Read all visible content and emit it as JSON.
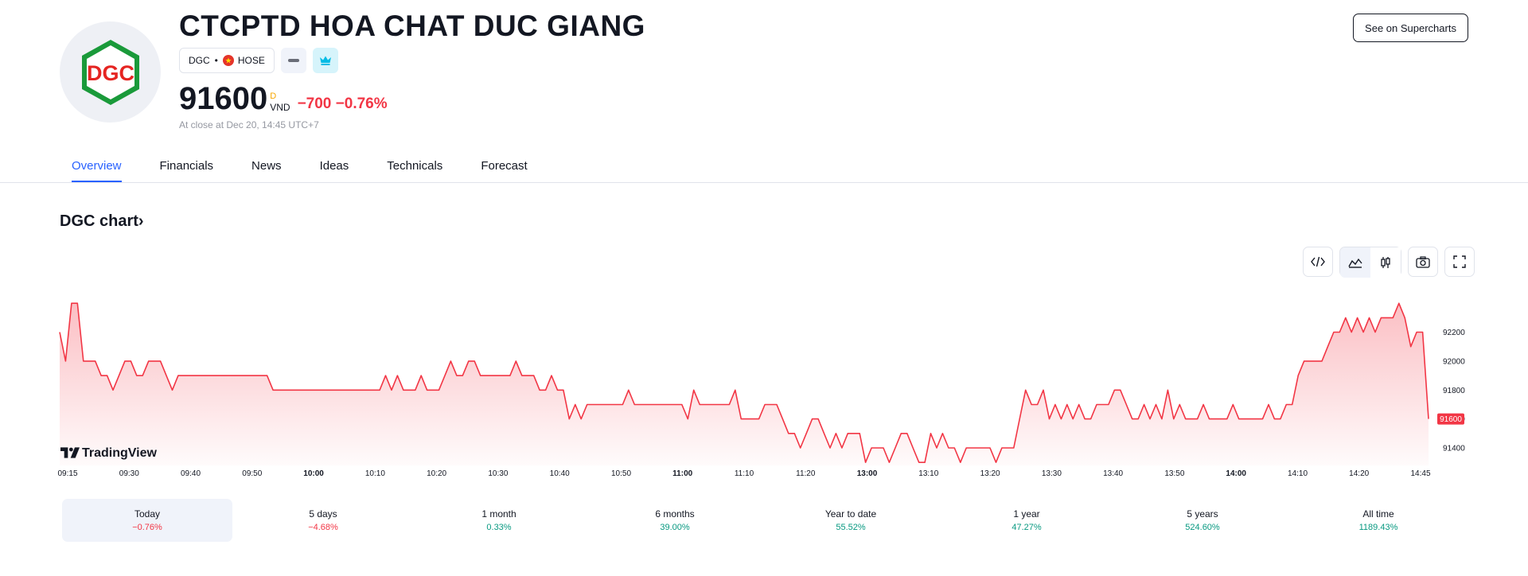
{
  "header": {
    "company_name": "CTCPTD HOA CHAT DUC GIANG",
    "logo_text": "DGC",
    "ticker": "DGC",
    "exchange": "HOSE",
    "price": "91600",
    "price_flag": "D",
    "currency": "VND",
    "change": "−700",
    "change_percent": "−0.76%",
    "close_note": "At close at Dec 20, 14:45 UTC+7",
    "supercharts_label": "See on Supercharts"
  },
  "tabs": [
    "Overview",
    "Financials",
    "News",
    "Ideas",
    "Technicals",
    "Forecast"
  ],
  "chart_section": {
    "title": "DGC chart",
    "title_chevron": "›",
    "watermark": "TradingView",
    "last_price_label": "91600"
  },
  "periods": [
    {
      "label": "Today",
      "value": "−0.76%",
      "trend": "neg"
    },
    {
      "label": "5 days",
      "value": "−4.68%",
      "trend": "neg"
    },
    {
      "label": "1 month",
      "value": "0.33%",
      "trend": "pos"
    },
    {
      "label": "6 months",
      "value": "39.00%",
      "trend": "pos"
    },
    {
      "label": "Year to date",
      "value": "55.52%",
      "trend": "pos"
    },
    {
      "label": "1 year",
      "value": "47.27%",
      "trend": "pos"
    },
    {
      "label": "5 years",
      "value": "524.60%",
      "trend": "pos"
    },
    {
      "label": "All time",
      "value": "1189.43%",
      "trend": "pos"
    }
  ],
  "colors": {
    "accent": "#2962ff",
    "negative": "#f23645",
    "positive": "#089981",
    "line": "#f23645"
  },
  "chart_data": {
    "type": "area",
    "title": "DGC chart",
    "xlabel": "",
    "ylabel": "",
    "x_ticks": [
      "09:15",
      "09:30",
      "09:40",
      "09:50",
      "10:00",
      "10:10",
      "10:20",
      "10:30",
      "10:40",
      "10:50",
      "11:00",
      "11:10",
      "11:20",
      "13:00",
      "13:10",
      "13:20",
      "13:30",
      "13:40",
      "13:50",
      "14:00",
      "14:10",
      "14:20",
      "14:45"
    ],
    "x_ticks_bold": [
      "10:00",
      "11:00",
      "13:00",
      "14:00"
    ],
    "y_ticks": [
      91400,
      91600,
      91800,
      92000,
      92200
    ],
    "ylim": [
      91290,
      92500
    ],
    "grid": false,
    "series": [
      {
        "values": [
          92200,
          92000,
          92400,
          92400,
          92000,
          92000,
          92000,
          91900,
          91900,
          91800,
          91900,
          92000,
          92000,
          91900,
          91900,
          92000,
          92000,
          92000,
          91900,
          91800,
          91900,
          91900,
          91900,
          91900,
          91900,
          91900,
          91900,
          91900,
          91900,
          91900,
          91900,
          91900,
          91900,
          91900,
          91900,
          91900,
          91800,
          91800,
          91800,
          91800,
          91800,
          91800,
          91800,
          91800,
          91800,
          91800,
          91800,
          91800,
          91800,
          91800,
          91800,
          91800,
          91800,
          91800,
          91800,
          91900,
          91800,
          91900,
          91800,
          91800,
          91800,
          91900,
          91800,
          91800,
          91800,
          91900,
          92000,
          91900,
          91900,
          92000,
          92000,
          91900,
          91900,
          91900,
          91900,
          91900,
          91900,
          92000,
          91900,
          91900,
          91900,
          91800,
          91800,
          91900,
          91800,
          91800,
          91600,
          91700,
          91600,
          91700,
          91700,
          91700,
          91700,
          91700,
          91700,
          91700,
          91800,
          91700,
          91700,
          91700,
          91700,
          91700,
          91700,
          91700,
          91700,
          91700,
          91600,
          91800,
          91700,
          91700,
          91700,
          91700,
          91700,
          91700,
          91800,
          91600,
          91600,
          91600,
          91600,
          91700,
          91700,
          91700,
          91600,
          91500,
          91500,
          91400,
          91500,
          91600,
          91600,
          91500,
          91400,
          91500,
          91400,
          91500,
          91500,
          91500,
          91300,
          91400,
          91400,
          91400,
          91300,
          91400,
          91500,
          91500,
          91400,
          91300,
          91300,
          91500,
          91400,
          91500,
          91400,
          91400,
          91300,
          91400,
          91400,
          91400,
          91400,
          91400,
          91300,
          91400,
          91400,
          91400,
          91600,
          91800,
          91700,
          91700,
          91800,
          91600,
          91700,
          91600,
          91700,
          91600,
          91700,
          91600,
          91600,
          91700,
          91700,
          91700,
          91800,
          91800,
          91700,
          91600,
          91600,
          91700,
          91600,
          91700,
          91600,
          91800,
          91600,
          91700,
          91600,
          91600,
          91600,
          91700,
          91600,
          91600,
          91600,
          91600,
          91700,
          91600,
          91600,
          91600,
          91600,
          91600,
          91700,
          91600,
          91600,
          91700,
          91700,
          91900,
          92000,
          92000,
          92000,
          92000,
          92100,
          92200,
          92200,
          92300,
          92200,
          92300,
          92200,
          92300,
          92200,
          92300,
          92300,
          92300,
          92400,
          92300,
          92100,
          92200,
          92200,
          91600
        ]
      }
    ]
  }
}
